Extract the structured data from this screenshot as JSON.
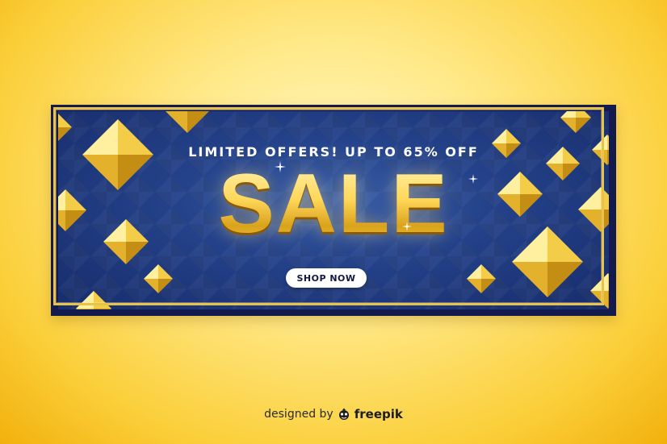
{
  "banner": {
    "headline": "LIMITED OFFERS! UP TO 65% OFF",
    "title": "SALE",
    "button_label": "SHOP NOW"
  },
  "credit": {
    "prefix": "designed by",
    "brand": "freepik"
  },
  "colors": {
    "background": "#fbcf3a",
    "banner_navy": "#1b2f72",
    "gold": "#e9c24c",
    "button": "#ffffff"
  }
}
